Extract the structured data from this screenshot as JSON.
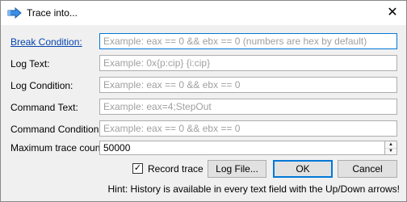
{
  "window": {
    "title": "Trace into..."
  },
  "title_icon": "arrow-into-icon",
  "close_icon": "close-icon",
  "close_glyph": "✕",
  "fields": {
    "break_condition": {
      "label": "Break Condition:",
      "placeholder": "Example: eax == 0 && ebx == 0 (numbers are hex by default)"
    },
    "log_text": {
      "label": "Log Text:",
      "placeholder": "Example: 0x{p:cip} {i:cip}"
    },
    "log_condition": {
      "label": "Log Condition:",
      "placeholder": "Example: eax == 0 && ebx == 0"
    },
    "command_text": {
      "label": "Command Text:",
      "placeholder": "Example: eax=4;StepOut"
    },
    "command_condition": {
      "label": "Command Condition:",
      "placeholder": "Example: eax == 0 && ebx == 0"
    },
    "max_trace_count": {
      "label": "Maximum trace count:",
      "value": "50000"
    }
  },
  "spin": {
    "up": "▲",
    "down": "▼"
  },
  "record_trace": {
    "label": "Record trace",
    "checked": true,
    "check_glyph": "✓"
  },
  "buttons": {
    "log_file": "Log File...",
    "ok": "OK",
    "cancel": "Cancel"
  },
  "hint": "Hint: History is available in every text field with the Up/Down arrows!",
  "colors": {
    "accent": "#0078d7",
    "link": "#0645ad"
  }
}
